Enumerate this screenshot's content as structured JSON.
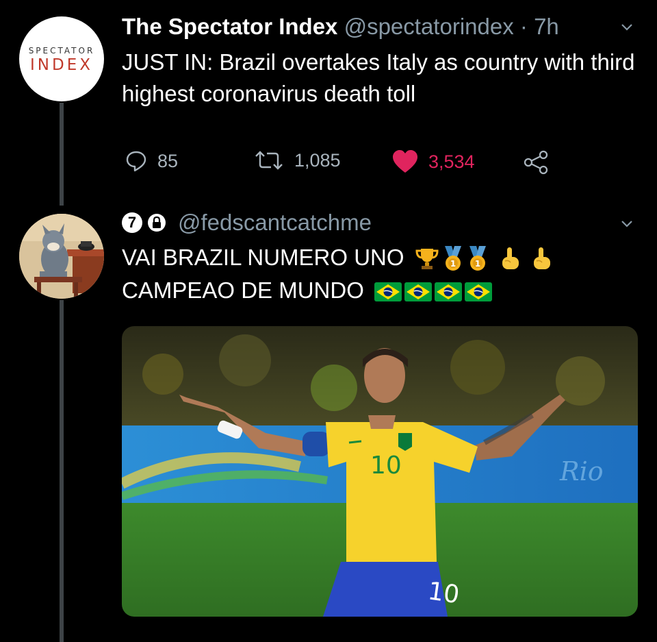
{
  "tweet": {
    "avatar_line1": "SPECTATOR",
    "avatar_line2": "INDEX",
    "author_name": "The Spectator Index",
    "author_handle": "@spectatorindex",
    "separator": "·",
    "time": "7h",
    "text": "JUST IN: Brazil overtakes Italy as country with third highest coronavirus death toll",
    "reply_count": "85",
    "retweet_count": "1,085",
    "like_count": "3,534",
    "icons": {
      "reply": "reply-icon",
      "retweet": "retweet-icon",
      "like": "heart-icon",
      "share": "share-icon",
      "menu": "chevron-down-icon"
    },
    "colors": {
      "like": "#e0245e",
      "muted": "#8899a6",
      "brand_red": "#c0392b"
    }
  },
  "reply": {
    "badge": "7",
    "author_handle": "@fedscantcatchme",
    "line1": "VAI BRAZIL NUMERO UNO",
    "line2": "CAMPEAO DE MUNDO",
    "line1_emojis": [
      "trophy-emoji",
      "gold-medal-emoji",
      "gold-medal-emoji",
      "pointing-up-emoji",
      "pointing-up-emoji"
    ],
    "line2_emojis": [
      "brazil-flag-emoji",
      "brazil-flag-emoji",
      "brazil-flag-emoji",
      "brazil-flag-emoji"
    ],
    "media_jersey_number": "10"
  }
}
